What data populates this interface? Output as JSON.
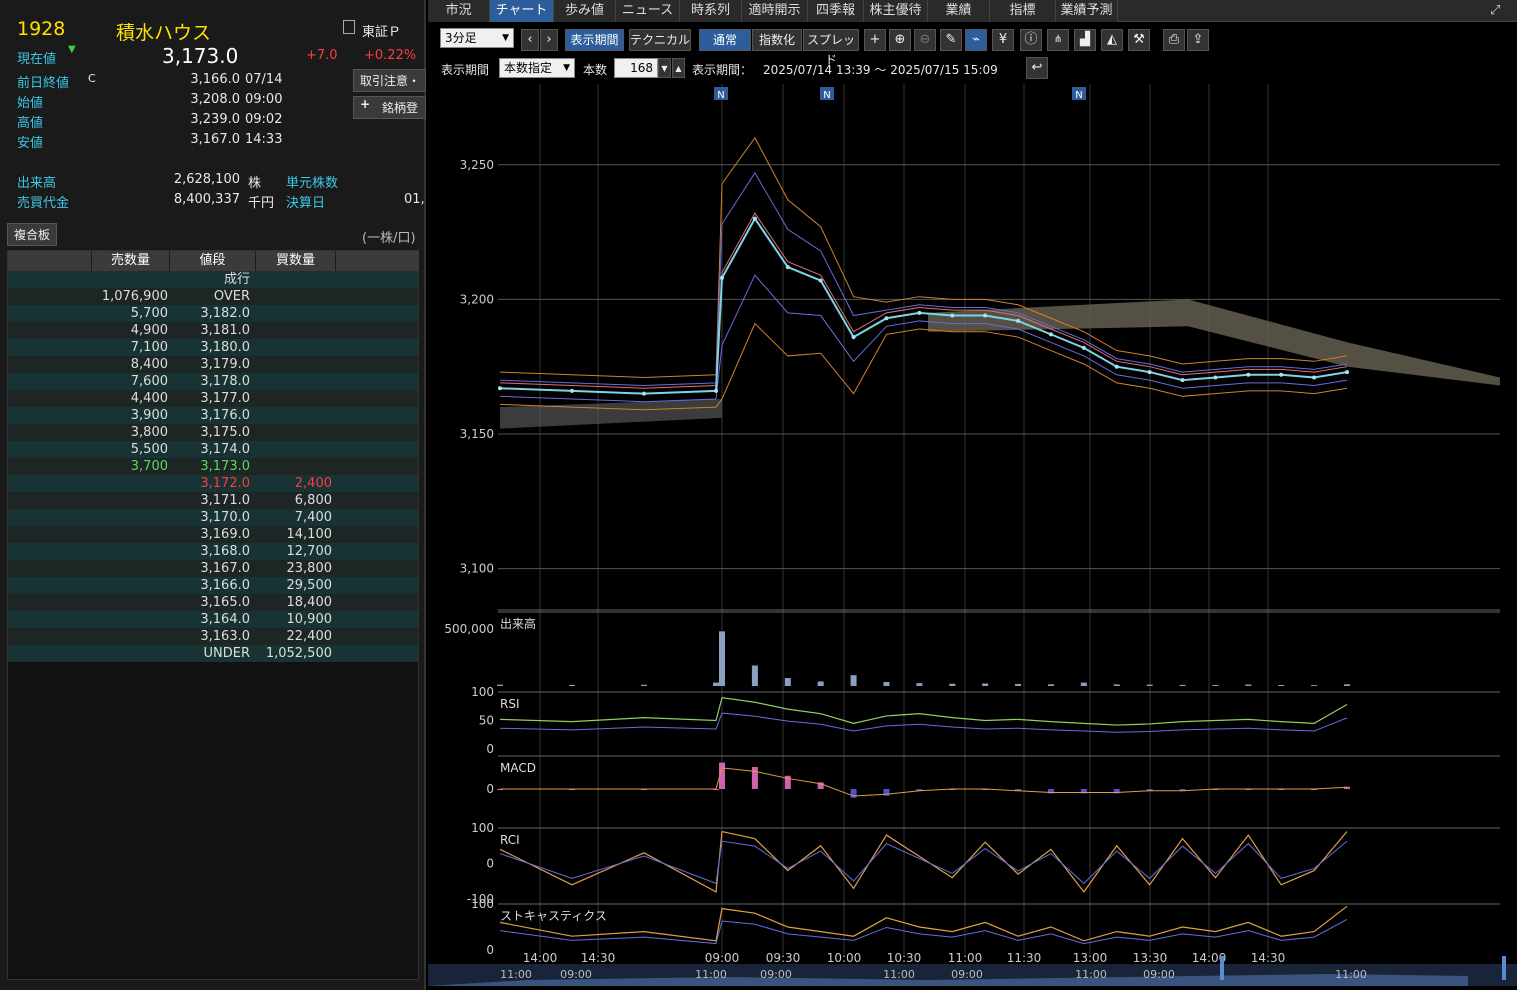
{
  "stock": {
    "code": "1928",
    "name": "積水ハウス",
    "market": "東証Ｐ",
    "price_label": "現在値",
    "price": "3,173.0",
    "change": "+7.0",
    "change_pct": "+0.22%",
    "trade_caution_button": "取引注意・",
    "add_button": "銘柄登",
    "rows": [
      {
        "label": "前日終値",
        "flag": "C",
        "value": "3,166.0",
        "time": "07/14"
      },
      {
        "label": "始値",
        "flag": "",
        "value": "3,208.0",
        "time": "09:00"
      },
      {
        "label": "高値",
        "flag": "",
        "value": "3,239.0",
        "time": "09:02"
      },
      {
        "label": "安値",
        "flag": "",
        "value": "3,167.0",
        "time": "14:33"
      }
    ],
    "volume_label": "出来高",
    "volume": "2,628,100",
    "volume_unit": "株",
    "unit_shares_label": "単元株数",
    "turnover_label": "売買代金",
    "turnover": "8,400,337",
    "turnover_unit": "千円",
    "settlement_label": "決算日",
    "settlement_value": "01,"
  },
  "board": {
    "title": "複合板",
    "unit": "(一株/口)",
    "headers": [
      "売数量",
      "値段",
      "買数量"
    ],
    "rows": [
      {
        "sell": "",
        "price": "成行",
        "buy": ""
      },
      {
        "sell": "1,076,900",
        "price": "OVER",
        "buy": ""
      },
      {
        "sell": "5,700",
        "price": "3,182.0",
        "buy": ""
      },
      {
        "sell": "4,900",
        "price": "3,181.0",
        "buy": ""
      },
      {
        "sell": "7,100",
        "price": "3,180.0",
        "buy": ""
      },
      {
        "sell": "8,400",
        "price": "3,179.0",
        "buy": ""
      },
      {
        "sell": "7,600",
        "price": "3,178.0",
        "buy": ""
      },
      {
        "sell": "4,400",
        "price": "3,177.0",
        "buy": ""
      },
      {
        "sell": "3,900",
        "price": "3,176.0",
        "buy": ""
      },
      {
        "sell": "3,800",
        "price": "3,175.0",
        "buy": ""
      },
      {
        "sell": "5,500",
        "price": "3,174.0",
        "buy": ""
      },
      {
        "sell": "3,700",
        "price": "3,173.0",
        "buy": "",
        "highlight": "green"
      },
      {
        "sell": "",
        "price": "3,172.0",
        "buy": "2,400",
        "highlight": "red"
      },
      {
        "sell": "",
        "price": "3,171.0",
        "buy": "6,800"
      },
      {
        "sell": "",
        "price": "3,170.0",
        "buy": "7,400"
      },
      {
        "sell": "",
        "price": "3,169.0",
        "buy": "14,100"
      },
      {
        "sell": "",
        "price": "3,168.0",
        "buy": "12,700"
      },
      {
        "sell": "",
        "price": "3,167.0",
        "buy": "23,800"
      },
      {
        "sell": "",
        "price": "3,166.0",
        "buy": "29,500"
      },
      {
        "sell": "",
        "price": "3,165.0",
        "buy": "18,400"
      },
      {
        "sell": "",
        "price": "3,164.0",
        "buy": "10,900"
      },
      {
        "sell": "",
        "price": "3,163.0",
        "buy": "22,400"
      },
      {
        "sell": "",
        "price": "UNDER",
        "buy": "1,052,500"
      }
    ]
  },
  "tabs": [
    "市況",
    "チャート",
    "歩み値",
    "ニュース",
    "時系列",
    "適時開示",
    "四季報",
    "株主優待",
    "業績",
    "指標",
    "業績予測"
  ],
  "active_tab": "チャート",
  "toolbar": {
    "interval": "3分足",
    "display_period_button": "表示期間",
    "technical_button": "テクニカル",
    "normal_button": "通常",
    "index_button": "指数化",
    "spread_button": "スプレッド"
  },
  "period_bar": {
    "label": "表示期間",
    "mode": "本数指定",
    "count_label": "本数",
    "count": "168",
    "range_label": "表示期間：",
    "range": "2025/07/14 13:39 ～ 2025/07/15 15:09"
  },
  "colors": {
    "accent_blue": "#2d5e9b",
    "price_up": "#ff3b3b",
    "label_cyan": "#3cc8e6",
    "code_yellow": "#ffe000"
  },
  "chart_data": {
    "type": "line",
    "title": "",
    "news_markers": [
      "N",
      "N",
      "N"
    ],
    "y_ticks": [
      "3,250",
      "3,200",
      "3,150",
      "3,100"
    ],
    "ylim": [
      3085,
      3280
    ],
    "x_ticks": [
      "14:00",
      "14:30",
      "09:00",
      "09:30",
      "10:00",
      "10:30",
      "11:00",
      "11:30",
      "13:00",
      "13:30",
      "14:00",
      "14:30"
    ],
    "nav_ticks": [
      "11:00",
      "09:00",
      "11:00",
      "09:00",
      "11:00",
      "09:00",
      "11:00",
      "09:00",
      "11:00"
    ],
    "price": {
      "x": [
        "13:39",
        "14:00",
        "14:30",
        "15:00",
        "09:00",
        "09:02",
        "09:10",
        "09:30",
        "09:45",
        "10:00",
        "10:15",
        "10:30",
        "10:45",
        "11:00",
        "11:15",
        "11:30",
        "13:00",
        "13:15",
        "13:30",
        "13:45",
        "14:00",
        "14:15",
        "14:30",
        "15:00"
      ],
      "close": [
        3167,
        3166,
        3165,
        3166,
        3208,
        3230,
        3212,
        3207,
        3186,
        3193,
        3195,
        3194,
        3194,
        3192,
        3187,
        3182,
        3175,
        3173,
        3170,
        3171,
        3172,
        3172,
        3171,
        3173
      ]
    },
    "panels": [
      {
        "name": "出来高",
        "ytick": "500,000",
        "volumes": [
          12000,
          9000,
          11000,
          30000,
          480000,
          180000,
          70000,
          40000,
          95000,
          35000,
          25000,
          20000,
          22000,
          18000,
          15000,
          30000,
          14000,
          12000,
          10000,
          9000,
          13000,
          9000,
          8000,
          15000
        ]
      },
      {
        "name": "RSI",
        "yticks": [
          "100",
          "50",
          "0"
        ],
        "values": [
          52,
          48,
          55,
          50,
          90,
          82,
          70,
          62,
          45,
          58,
          62,
          55,
          50,
          52,
          48,
          45,
          42,
          44,
          48,
          50,
          52,
          48,
          45,
          78
        ]
      },
      {
        "name": "MACD",
        "yticks": [
          "0"
        ],
        "values": [
          0,
          0,
          0,
          0,
          12,
          10,
          6,
          3,
          -4,
          -3,
          -1,
          0,
          0,
          -1,
          -2,
          -2,
          -2,
          -1,
          -1,
          0,
          0,
          0,
          0,
          1
        ]
      },
      {
        "name": "RCI",
        "yticks": [
          "100",
          "0",
          "-100"
        ],
        "values": [
          40,
          -60,
          30,
          -80,
          90,
          70,
          -20,
          50,
          -70,
          80,
          20,
          -40,
          60,
          -30,
          40,
          -80,
          50,
          -60,
          70,
          -40,
          80,
          -60,
          -20,
          90
        ]
      },
      {
        "name": "ストキャスティクス",
        "yticks": [
          "100",
          "0"
        ],
        "values": [
          60,
          30,
          40,
          20,
          90,
          80,
          50,
          40,
          30,
          70,
          50,
          40,
          60,
          30,
          50,
          20,
          40,
          30,
          50,
          40,
          60,
          30,
          40,
          95
        ]
      }
    ]
  }
}
